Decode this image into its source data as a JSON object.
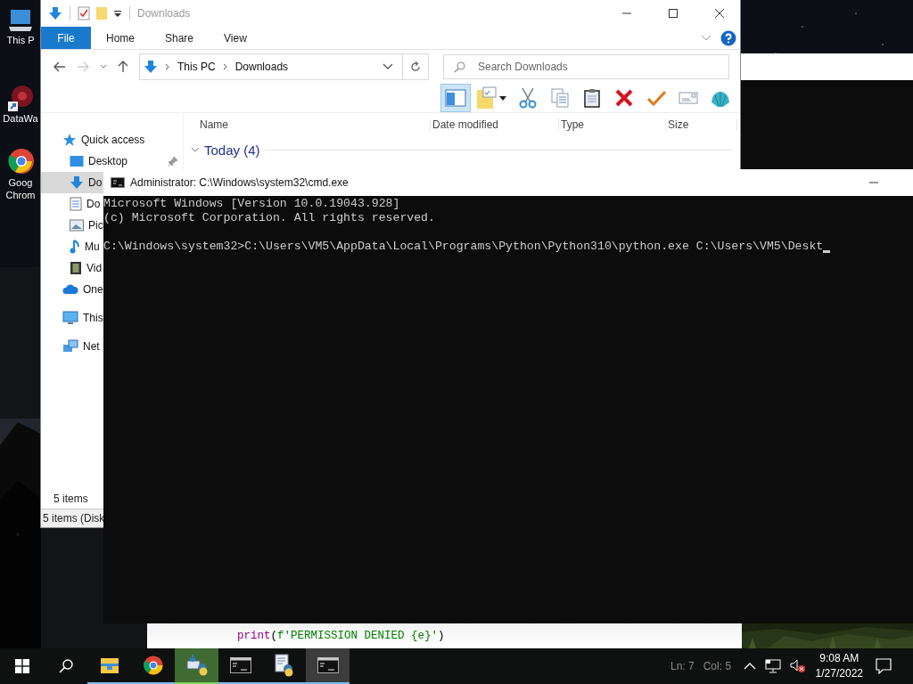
{
  "desktop_icons": [
    {
      "kind": "pc",
      "lines": [
        "This P"
      ]
    },
    {
      "kind": "shortcut",
      "lines": [
        "DataWa"
      ]
    },
    {
      "kind": "chrome",
      "lines": [
        "Goog",
        "Chrom"
      ]
    }
  ],
  "explorer": {
    "title": "Downloads",
    "ribbon_tabs": [
      {
        "label": "File",
        "selected": true
      },
      {
        "label": "Home",
        "selected": false
      },
      {
        "label": "Share",
        "selected": false
      },
      {
        "label": "View",
        "selected": false
      }
    ],
    "address": {
      "path": [
        "This PC",
        "Downloads"
      ]
    },
    "search": {
      "placeholder": "Search Downloads"
    },
    "toolbar": [
      {
        "kind": "pane",
        "selected": true
      },
      {
        "kind": "properties",
        "selected": false
      },
      {
        "kind": "cut",
        "selected": false
      },
      {
        "kind": "copy",
        "selected": false
      },
      {
        "kind": "paste",
        "selected": false
      },
      {
        "kind": "delete",
        "selected": false
      },
      {
        "kind": "check",
        "selected": false
      },
      {
        "kind": "mail",
        "selected": false
      },
      {
        "kind": "shell",
        "selected": false
      }
    ],
    "nav": [
      {
        "label": "Quick access",
        "kind": "star",
        "selected": false,
        "children": [
          {
            "label": "Desktop",
            "kind": "desktop",
            "selected": false,
            "pinned": true
          },
          {
            "label": "Do",
            "kind": "download",
            "selected": true,
            "pinned": false
          },
          {
            "label": "Do",
            "kind": "document",
            "selected": false,
            "pinned": false
          },
          {
            "label": "Pic",
            "kind": "pictures",
            "selected": false,
            "pinned": false
          },
          {
            "label": "Mu",
            "kind": "music",
            "selected": false,
            "pinned": false
          },
          {
            "label": "Vid",
            "kind": "video",
            "selected": false,
            "pinned": false
          }
        ]
      },
      {
        "label": "One",
        "kind": "cloud",
        "selected": false
      },
      {
        "label": "This",
        "kind": "pc",
        "selected": false
      },
      {
        "label": "Net",
        "kind": "network",
        "selected": false
      }
    ],
    "columns": [
      "Name",
      "Date modified",
      "Type",
      "Size"
    ],
    "group": "Today (4)",
    "item_count": "5 items",
    "status_bar": "5 items (Disk"
  },
  "cmd": {
    "title": "Administrator: C:\\Windows\\system32\\cmd.exe",
    "blocks": [
      [
        "Microsoft Windows [Version 10.0.19043.928]",
        "(c) Microsoft Corporation. All rights reserved."
      ],
      [
        "C:\\Windows\\system32>C:\\Users\\VM5\\AppData\\Local\\Programs\\Python\\Python310\\python.exe C:\\Users\\VM5\\Deskt"
      ]
    ]
  },
  "editor": {
    "code": [
      {
        "text": "print",
        "kind": "builtin"
      },
      {
        "text": "(",
        "kind": "plain"
      },
      {
        "text": "f'PERMISSION DENIED {e}'",
        "kind": "string"
      },
      {
        "text": ")",
        "kind": "plain"
      }
    ],
    "status": [
      "Ln: 7",
      "Col: 5"
    ]
  },
  "taskbar": {
    "apps": [
      {
        "kind": "explorer",
        "selected": false,
        "flashing": false
      },
      {
        "kind": "chrome",
        "selected": false,
        "flashing": false
      },
      {
        "kind": "python-setup",
        "selected": false,
        "flashing": true
      },
      {
        "kind": "terminal",
        "selected": false,
        "flashing": false
      },
      {
        "kind": "python-file",
        "selected": false,
        "flashing": false
      },
      {
        "kind": "terminal",
        "selected": true,
        "flashing": false
      }
    ],
    "clock": {
      "time": "9:08 AM",
      "date": "1/27/2022"
    }
  }
}
